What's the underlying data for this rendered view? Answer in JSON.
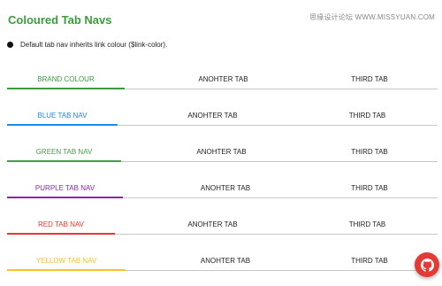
{
  "header": {
    "title": "Coloured Tab Navs",
    "watermark": "思缘设计论坛 WWW.MISSYUAN.COM"
  },
  "note": {
    "text": "Default tab nav inherits link colour ($link-color)."
  },
  "tabnavs": [
    {
      "accent": "#3d9b3d",
      "tabs": [
        "BRAND COLOUR",
        "ANOHTER TAB",
        "THIRD TAB"
      ]
    },
    {
      "accent": "#1e88e5",
      "tabs": [
        "BLUE TAB NAV",
        "ANOHTER TAB",
        "THIRD TAB"
      ]
    },
    {
      "accent": "#43a047",
      "tabs": [
        "GREEN TAB NAV",
        "ANOHTER TAB",
        "THIRD TAB"
      ]
    },
    {
      "accent": "#8e24aa",
      "tabs": [
        "PURPLE TAB NAV",
        "ANOHTER TAB",
        "THIRD TAB"
      ]
    },
    {
      "accent": "#e53935",
      "tabs": [
        "RED TAB NAV",
        "ANOHTER TAB",
        "THIRD TAB"
      ]
    },
    {
      "accent": "#fbc02d",
      "tabs": [
        "YELLOW TAB NAV",
        "ANOHTER TAB",
        "THIRD TAB"
      ]
    }
  ],
  "fab": {
    "icon": "github-icon",
    "color": "#e53935"
  }
}
